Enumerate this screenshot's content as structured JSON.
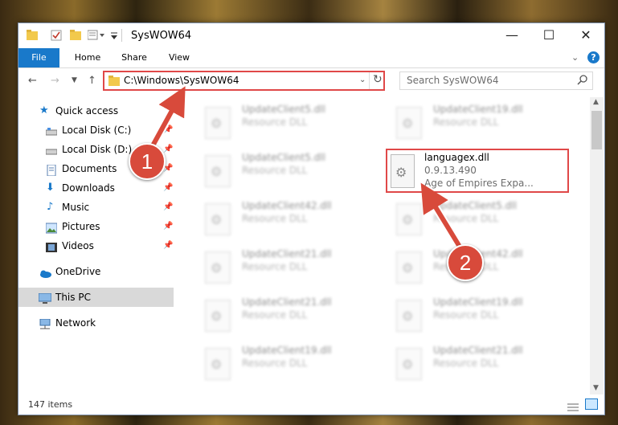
{
  "window": {
    "title": "SysWOW64",
    "controls": [
      "—",
      "☐",
      "✕"
    ]
  },
  "ribbon": {
    "tabs": [
      "File",
      "Home",
      "Share",
      "View"
    ]
  },
  "address": {
    "path": "C:\\Windows\\SysWOW64",
    "search_placeholder": "Search SysWOW64"
  },
  "sidebar": {
    "items": [
      {
        "label": "Quick access",
        "icon": "star-icon"
      },
      {
        "label": "Local Disk (C:)",
        "icon": "drive-icon",
        "pinned": true
      },
      {
        "label": "Local Disk (D:)",
        "icon": "drive-icon",
        "pinned": true
      },
      {
        "label": "Documents",
        "icon": "documents-icon",
        "pinned": true
      },
      {
        "label": "Downloads",
        "icon": "download-icon",
        "pinned": true
      },
      {
        "label": "Music",
        "icon": "music-icon",
        "pinned": true
      },
      {
        "label": "Pictures",
        "icon": "pictures-icon",
        "pinned": true
      },
      {
        "label": "Videos",
        "icon": "videos-icon",
        "pinned": true
      },
      {
        "label": "OneDrive",
        "icon": "cloud-icon"
      },
      {
        "label": "This PC",
        "icon": "computer-icon",
        "selected": true
      },
      {
        "label": "Network",
        "icon": "network-icon"
      }
    ]
  },
  "files": {
    "left": [
      {
        "name": "UpdateClient5.dll",
        "desc": "Resource DLL"
      },
      {
        "name": "UpdateClient5.dll",
        "desc": "Resource DLL"
      },
      {
        "name": "UpdateClient42.dll",
        "desc": "Resource DLL"
      },
      {
        "name": "UpdateClient21.dll",
        "desc": "Resource DLL"
      },
      {
        "name": "UpdateClient21.dll",
        "desc": "Resource DLL"
      },
      {
        "name": "UpdateClient19.dll",
        "desc": "Resource DLL"
      }
    ],
    "right": [
      {
        "name": "UpdateClient19.dll",
        "desc": "Resource DLL"
      },
      {
        "name": "",
        "desc": ""
      },
      {
        "name": "UpdateClient5.dll",
        "desc": "Resource DLL"
      },
      {
        "name": "UpdateClient42.dll",
        "desc": "Resource DLL"
      },
      {
        "name": "UpdateClient19.dll",
        "desc": "Resource DLL"
      },
      {
        "name": "UpdateClient21.dll",
        "desc": "Resource DLL"
      }
    ],
    "highlighted": {
      "name": "languagex.dll",
      "version": "0.9.13.490",
      "company": "Age of Empires Expa..."
    }
  },
  "status": {
    "count": "147 items"
  },
  "callouts": [
    "1",
    "2"
  ],
  "colors": {
    "accent": "#1979ca",
    "highlight": "#e04848",
    "callout": "#d84a3b"
  }
}
